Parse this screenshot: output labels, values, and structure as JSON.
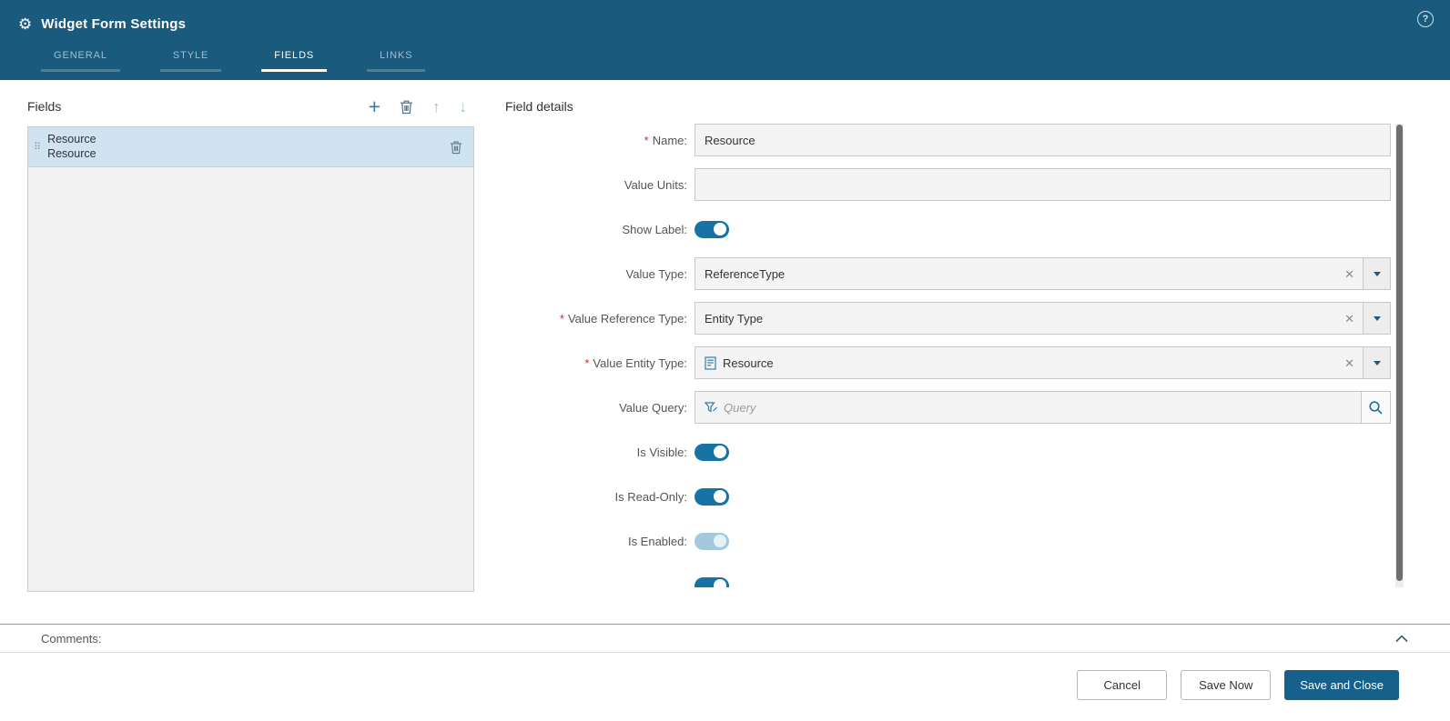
{
  "colors": {
    "header_bg": "#1a5a7d",
    "accent_blue": "#2e7fae",
    "toggle_on": "#1773a5",
    "toggle_disabled": "#a3c9de",
    "selected_item_bg": "#cfe3f1",
    "input_bg": "#f4f4f4",
    "primary_button_bg": "#15618c",
    "required_red": "#c9302c"
  },
  "header": {
    "title": "Widget Form Settings",
    "gear_glyph": "⚙",
    "help_glyph": "?",
    "tabs": [
      {
        "label": "GENERAL",
        "active": false
      },
      {
        "label": "STYLE",
        "active": false
      },
      {
        "label": "FIELDS",
        "active": true
      },
      {
        "label": "LINKS",
        "active": false
      }
    ]
  },
  "fields_panel": {
    "title": "Fields",
    "toolbar": {
      "add_glyph": "+",
      "move_up_glyph": "↑",
      "move_down_glyph": "↓"
    },
    "items": [
      {
        "line1": "Resource",
        "line2": "Resource",
        "selected": true,
        "drag_glyph": "⠿"
      }
    ]
  },
  "details_panel": {
    "title": "Field details",
    "required_marker": "*",
    "clear_glyph": "✕",
    "rows": [
      {
        "label": "Name:",
        "required": true,
        "control": "text",
        "value": "Resource"
      },
      {
        "label": "Value Units:",
        "required": false,
        "control": "text",
        "value": ""
      },
      {
        "label": "Show Label:",
        "required": false,
        "control": "toggle",
        "on": true
      },
      {
        "label": "Value Type:",
        "required": false,
        "control": "combo",
        "value": "ReferenceType"
      },
      {
        "label": "Value Reference Type:",
        "required": true,
        "control": "combo",
        "value": "Entity Type"
      },
      {
        "label": "Value Entity Type:",
        "required": true,
        "control": "combo",
        "value": "Resource",
        "has_icon": true
      },
      {
        "label": "Value Query:",
        "required": false,
        "control": "query",
        "placeholder": "Query"
      },
      {
        "label": "Is Visible:",
        "required": false,
        "control": "toggle",
        "on": true
      },
      {
        "label": "Is Read-Only:",
        "required": false,
        "control": "toggle",
        "on": true
      },
      {
        "label": "Is Enabled:",
        "required": false,
        "control": "toggle",
        "on": true,
        "disabled": true
      },
      {
        "label": "",
        "required": false,
        "control": "toggle",
        "on": true,
        "partial": true
      }
    ]
  },
  "comments": {
    "label": "Comments:"
  },
  "footer": {
    "cancel_label": "Cancel",
    "save_now_label": "Save Now",
    "save_close_label": "Save and Close"
  }
}
